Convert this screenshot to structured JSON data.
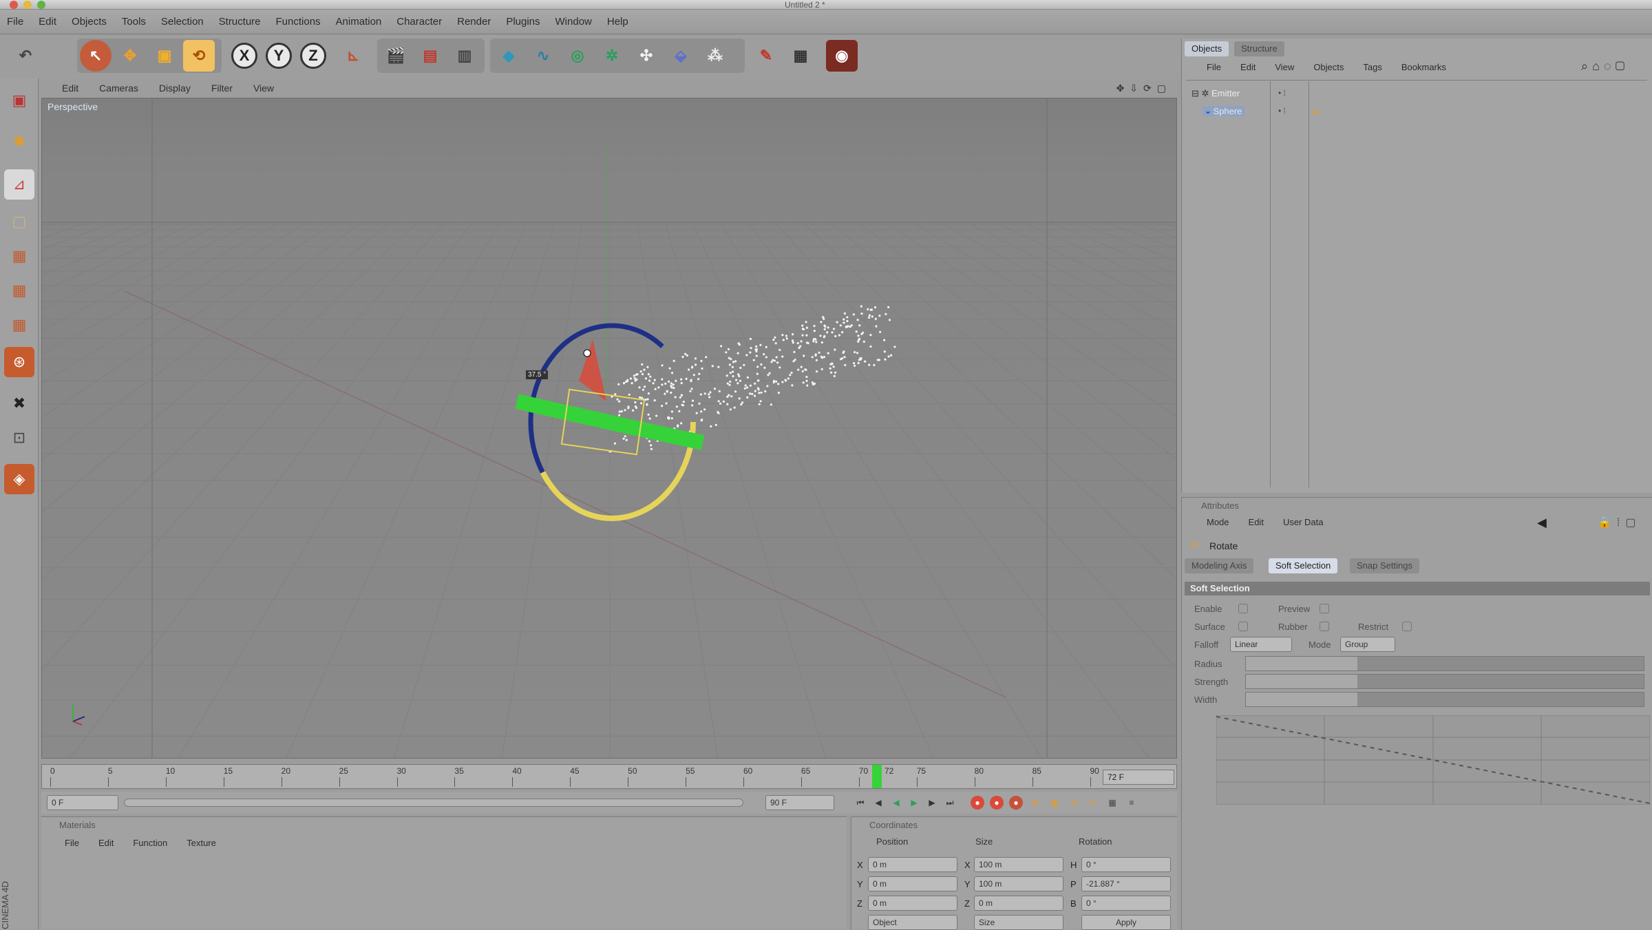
{
  "window": {
    "title": "Untitled 2 *"
  },
  "menubar": [
    "File",
    "Edit",
    "Objects",
    "Tools",
    "Selection",
    "Structure",
    "Functions",
    "Animation",
    "Character",
    "Render",
    "Plugins",
    "Window",
    "Help"
  ],
  "viewport": {
    "menu": [
      "Edit",
      "Cameras",
      "Display",
      "Filter",
      "View"
    ],
    "label": "Perspective",
    "hud_value": "37.5 °"
  },
  "timeline": {
    "ticks": [
      "0",
      "5",
      "10",
      "15",
      "20",
      "25",
      "30",
      "35",
      "40",
      "45",
      "50",
      "55",
      "60",
      "65",
      "70",
      "75",
      "80",
      "85",
      "90"
    ],
    "current_frame_label": "72",
    "end_frame": "72 F"
  },
  "transport": {
    "start_field": "0 F",
    "range_field": "90 F"
  },
  "materials": {
    "title": "Materials",
    "menu": [
      "File",
      "Edit",
      "Function",
      "Texture"
    ]
  },
  "coords": {
    "title": "Coordinates",
    "headers": [
      "Position",
      "Size",
      "Rotation"
    ],
    "rows": [
      {
        "axis": "X",
        "pos": "0 m",
        "size_axis": "X",
        "size": "100 m",
        "rot_axis": "H",
        "rot": "0 °"
      },
      {
        "axis": "Y",
        "pos": "0 m",
        "size_axis": "Y",
        "size": "100 m",
        "rot_axis": "P",
        "rot": "-21.887 °"
      },
      {
        "axis": "Z",
        "pos": "0 m",
        "size_axis": "Z",
        "size": "0 m",
        "rot_axis": "B",
        "rot": "0 °"
      }
    ],
    "mode_select": "Object",
    "size_select": "Size",
    "apply_label": "Apply"
  },
  "objects": {
    "tabs": [
      "Objects",
      "Structure"
    ],
    "menu": [
      "File",
      "Edit",
      "View",
      "Objects",
      "Tags",
      "Bookmarks"
    ],
    "items": [
      {
        "name": "Emitter"
      },
      {
        "name": "Sphere"
      }
    ]
  },
  "attributes": {
    "title": "Attributes",
    "menu": [
      "Mode",
      "Edit",
      "User Data"
    ],
    "tool_name": "Rotate",
    "tabs": [
      "Modeling Axis",
      "Soft Selection",
      "Snap Settings"
    ],
    "section": "Soft Selection",
    "row1": {
      "enable": "Enable",
      "preview": "Preview"
    },
    "row2": {
      "surface": "Surface",
      "rubber": "Rubber",
      "restrict": "Restrict"
    },
    "row3": {
      "falloff_label": "Falloff",
      "falloff_value": "Linear",
      "mode_label": "Mode",
      "mode_value": "Group"
    },
    "sliders": [
      {
        "label": "Radius",
        "level": 0.28
      },
      {
        "label": "Strength",
        "level": 0.28
      },
      {
        "label": "Width",
        "level": 0.28
      }
    ]
  },
  "watermark": "CINEMA 4D",
  "colors": {
    "accent": "#d6dce8",
    "x_axis": "#c0392b",
    "y_axis": "#3cb043",
    "z_axis": "#1e2f86",
    "gizmo_green": "#36d23a",
    "gizmo_yellow": "#e6d35a"
  },
  "icons": [
    "undo-icon",
    "move-icon",
    "scale-icon",
    "rotate-icon",
    "x-axis-icon",
    "y-axis-icon",
    "z-axis-icon",
    "coord-system-icon",
    "render-view-icon",
    "render-picture-icon",
    "render-settings-icon",
    "cube-icon",
    "spline-icon",
    "nurbs-icon",
    "array-icon",
    "deformer-icon",
    "scene-icon",
    "particle-icon",
    "light-icon",
    "camera-icon",
    "floor-icon"
  ]
}
